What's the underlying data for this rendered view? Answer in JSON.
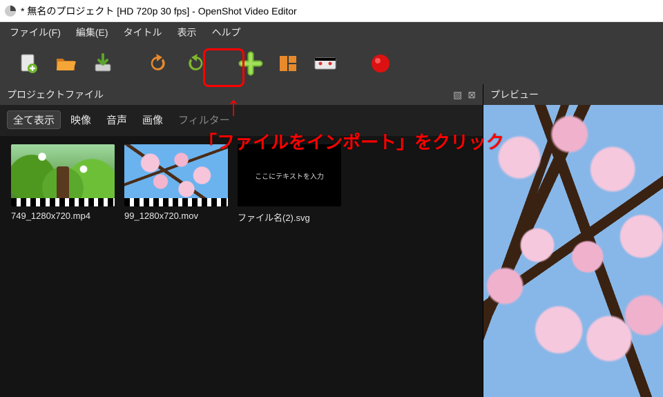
{
  "window_title": "* 無名のプロジェクト [HD 720p 30 fps] - OpenShot Video Editor",
  "menu": {
    "file": "ファイル(F)",
    "edit": "編集(E)",
    "title": "タイトル",
    "view": "表示",
    "help": "ヘルプ"
  },
  "panels": {
    "project_files": "プロジェクトファイル",
    "preview": "プレビュー"
  },
  "filters": {
    "all": "全て表示",
    "video": "映像",
    "audio": "音声",
    "image": "画像",
    "filter": "フィルター"
  },
  "items": [
    {
      "caption": "749_1280x720.mp4"
    },
    {
      "caption": "99_1280x720.mov"
    },
    {
      "caption": "ファイル名(2).svg",
      "title_card": "ここにテキストを入力"
    }
  ],
  "annotation": "「ファイルをインポート」をクリック",
  "toolbar": {
    "new": "new-file-icon",
    "open": "open-folder-icon",
    "save": "save-icon",
    "undo": "undo-icon",
    "redo": "redo-icon",
    "import": "plus-icon",
    "layout": "layout-icon",
    "marker": "marker-icon",
    "record": "record-icon"
  }
}
